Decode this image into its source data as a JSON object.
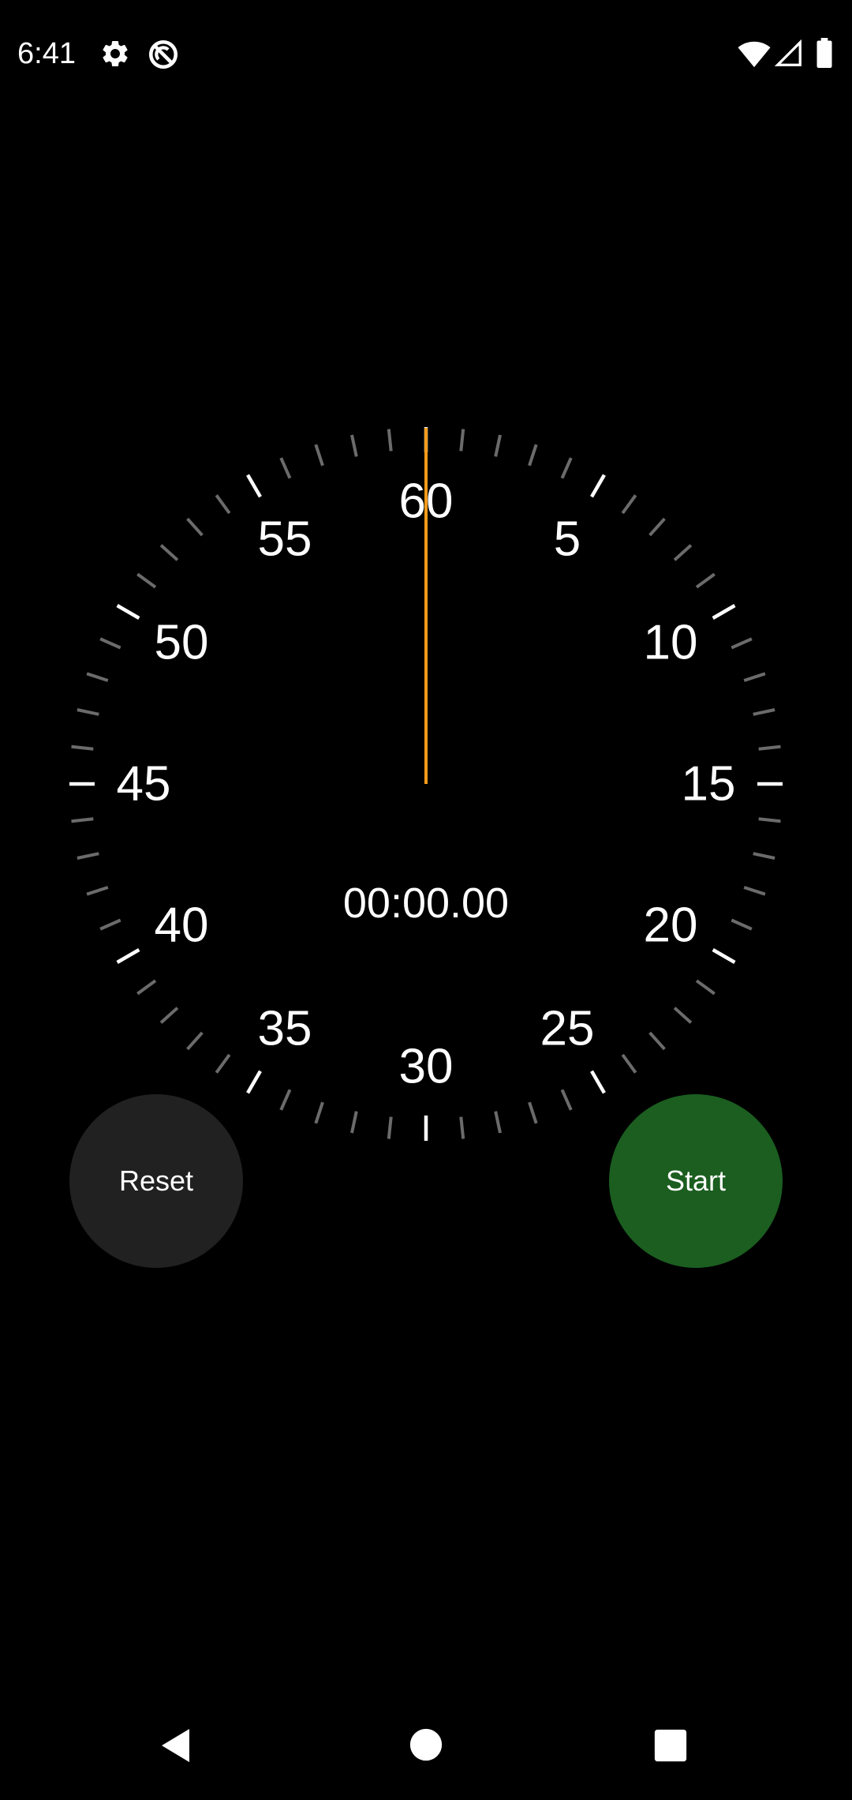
{
  "status_bar": {
    "time": "6:41",
    "left_icons": [
      "gear-icon",
      "no-sync-icon"
    ],
    "right_icons": [
      "wifi-icon",
      "cell-signal-icon",
      "battery-icon"
    ]
  },
  "stopwatch": {
    "elapsed_display": "00:00.00",
    "dial_numbers": [
      "60",
      "5",
      "10",
      "15",
      "20",
      "25",
      "30",
      "35",
      "40",
      "45",
      "50",
      "55"
    ],
    "hand_seconds": 0
  },
  "controls": {
    "reset_label": "Reset",
    "start_label": "Start"
  },
  "colors": {
    "background": "#000000",
    "hand": "#F59B1A",
    "major_tick": "#FFFFFF",
    "minor_tick": "#6B6B6B",
    "reset_button": "#212121",
    "start_button": "#1B5E20"
  },
  "nav_bar": {
    "icons": [
      "back-icon",
      "home-icon",
      "recents-icon"
    ]
  }
}
